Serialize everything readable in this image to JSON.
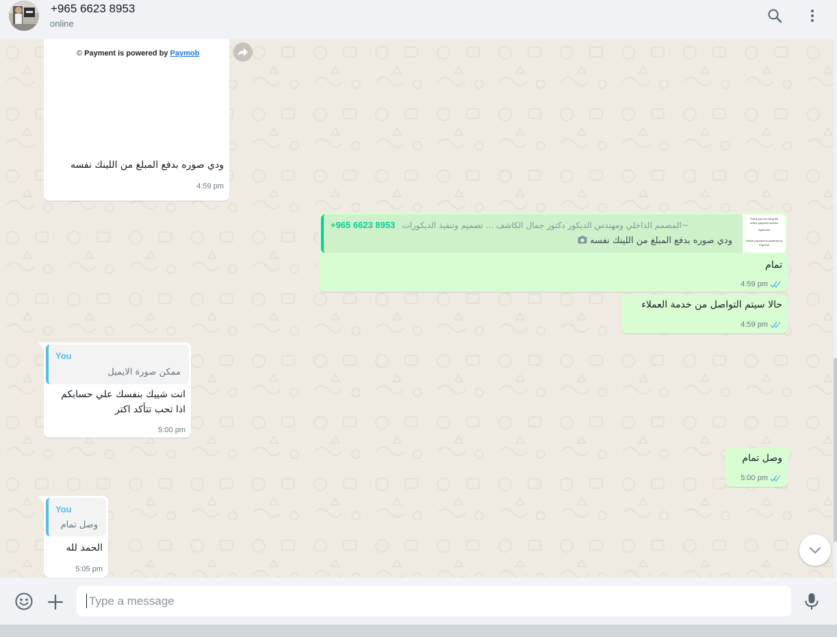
{
  "header": {
    "contact_name": "+965 6623 8953",
    "status": "online",
    "search_icon": "search-icon",
    "menu_icon": "menu-dots-icon"
  },
  "colors": {
    "incoming_bubble": "#ffffff",
    "outgoing_bubble": "#d9fdd3",
    "chat_background": "#efeae2",
    "read_ticks": "#53bdeb",
    "quote_accent_green": "#06cf9c",
    "quote_accent_blue": "#53bdeb"
  },
  "messages": [
    {
      "direction": "incoming",
      "image_caption_line": "Payment is powered by",
      "image_caption_link": "Paymob",
      "text": "ودي صوره بدفع المبلغ من اللينك نفسه",
      "time": "4:59 pm"
    },
    {
      "direction": "outgoing",
      "quote_author": "+965 6623 8953",
      "quote_group": "~المصمم الداخلي ومهندس الديكور دكتور جمال الكاشف ... تصميم وتنفيذ الديكورات",
      "quote_text": "ودي صوره بدفع المبلغ من اللينك نفسه",
      "quote_thumb_lines": [
        "Thank you for using the",
        "online payment service",
        "Approved",
        "Online payment is powered by Paymob"
      ],
      "text": "تمام",
      "time": "4:59 pm",
      "status": "read"
    },
    {
      "direction": "outgoing",
      "text": "حالا سيتم التواصل من خدمة العملاء",
      "time": "4:59 pm",
      "status": "read"
    },
    {
      "direction": "incoming",
      "quote_author": "You",
      "quote_text": "ممكن صورة الايميل",
      "text_lines": [
        "انت شييك بنفسك علي حسابكم",
        "اذا تحب تتأكد اكتر"
      ],
      "time": "5:00 pm"
    },
    {
      "direction": "outgoing",
      "text": "وصل تمام",
      "time": "5:00 pm",
      "status": "read"
    },
    {
      "direction": "incoming",
      "quote_author": "You",
      "quote_text": "وصل تمام",
      "text": "الحمد لله",
      "time": "5:05 pm"
    }
  ],
  "composer": {
    "placeholder": "Type a message",
    "emoji_icon": "emoji-icon",
    "attach_icon": "plus-icon",
    "mic_icon": "microphone-icon"
  },
  "scroll_down_icon": "chevron-down-icon",
  "forward_icon": "forward-icon"
}
